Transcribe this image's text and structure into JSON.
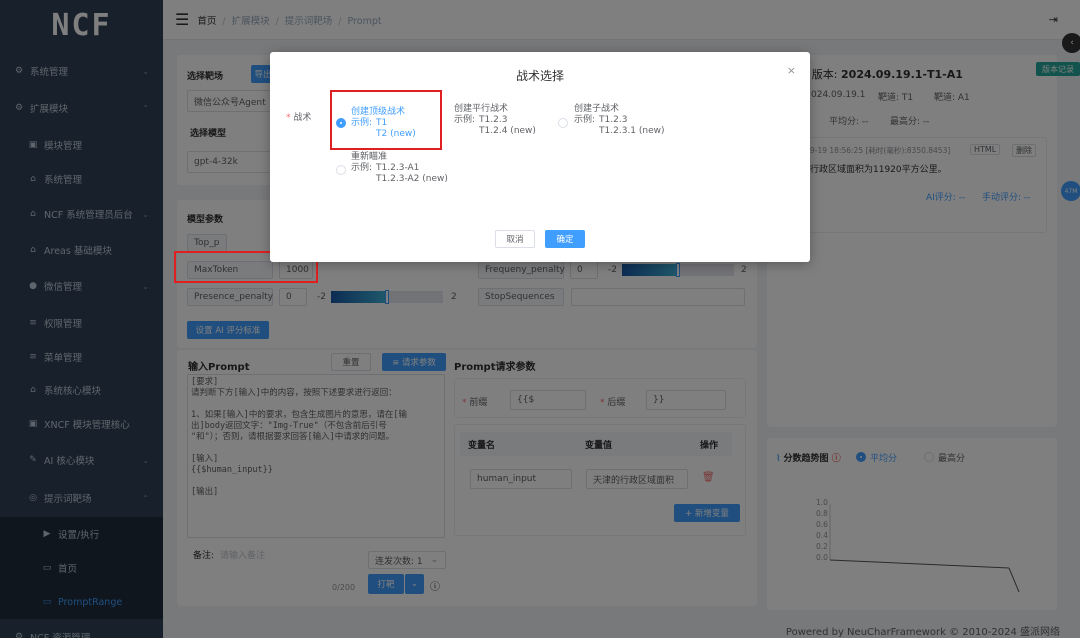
{
  "logo": "NCF",
  "sidebar": {
    "items": [
      {
        "icon": "⚙",
        "label": "系统管理",
        "arrow": "⌄"
      },
      {
        "icon": "⚙",
        "label": "扩展模块",
        "arrow": "⌃"
      },
      {
        "icon": "▣",
        "label": "模块管理",
        "arrow": ""
      },
      {
        "icon": "⌂",
        "label": "系统管理",
        "arrow": ""
      },
      {
        "icon": "⌂",
        "label": "NCF 系统管理员后台",
        "arrow": "⌄"
      },
      {
        "icon": "⌂",
        "label": "Areas 基础模块",
        "arrow": ""
      },
      {
        "icon": "●",
        "label": "微信管理",
        "arrow": "⌄"
      },
      {
        "icon": "≡",
        "label": "权限管理",
        "arrow": ""
      },
      {
        "icon": "≡",
        "label": "菜单管理",
        "arrow": ""
      },
      {
        "icon": "⌂",
        "label": "系统核心模块",
        "arrow": ""
      },
      {
        "icon": "▣",
        "label": "XNCF 模块管理核心",
        "arrow": ""
      },
      {
        "icon": "✎",
        "label": "AI 核心模块",
        "arrow": "⌄"
      },
      {
        "icon": "◎",
        "label": "提示词靶场",
        "arrow": "⌃"
      },
      {
        "icon": "▶",
        "label": "设置/执行",
        "arrow": ""
      },
      {
        "icon": "▭",
        "label": "首页",
        "arrow": ""
      },
      {
        "icon": "▭",
        "label": "PromptRange",
        "arrow": ""
      },
      {
        "icon": "⚙",
        "label": "NCF 资源管理",
        "arrow": "⌄"
      }
    ]
  },
  "breadcrumb": {
    "home": "首页",
    "module": "扩展模块",
    "range": "提示词靶场",
    "current": "Prompt"
  },
  "left": {
    "select_range_label": "选择靶场",
    "export_btn": "导出",
    "range_value": "微信公众号Agent",
    "select_model_label": "选择模型",
    "model_value": "gpt-4-32k",
    "params_title": "模型参数",
    "top_p": "Top_p",
    "max_token": "MaxToken",
    "max_token_value": "1000",
    "presence": "Presence_penalty",
    "presence_value": "0",
    "presence_min": "-2",
    "presence_max": "2",
    "frequency": "Frequeny_penalty",
    "frequency_value": "0",
    "frequency_min": "-2",
    "frequency_max": "2",
    "stop": "StopSequences",
    "ai_score_btn": "设置 AI 评分标准",
    "input_prompt_title": "输入Prompt",
    "reset_btn": "重置",
    "request_btn": "≡ 请求参数",
    "prompt_text": "[要求]\n请判断下方[输入]中的内容，按照下述要求进行返回：\n\n1、如果[输入]中的要求，包含生成图片的意思，请在[输\n出]body返回文字：\"Img-True\"（不包含前后引号\n\"和\"）；否则，请根据要求回答[输入]中请求的问题。\n\n[输入]\n{{$human_input}}\n\n[输出]",
    "note_label": "备注:",
    "note_placeholder": "请输入备注",
    "note_count": "0/200",
    "repeat_label": "连发次数: 1",
    "shoot_btn": "打靶"
  },
  "request_params": {
    "title": "Prompt请求参数",
    "prefix_label": "前缀",
    "prefix_value": "{{$",
    "suffix_label": "后缀",
    "suffix_value": "}}",
    "col_name": "变量名",
    "col_value": "变量值",
    "col_op": "操作",
    "row_name": "human_input",
    "row_value": "天津的行政区域面积",
    "add_btn": "+ 新增变量"
  },
  "right": {
    "version_prefix": "t 版本:",
    "version": "2024.09.19.1-T1-A1",
    "version_tag": "版本记录",
    "date": "024.09.19.1",
    "range_t": "靶道: T1",
    "arrow_a": "靶道: A1",
    "avg": "平均分: --",
    "max": "最高分: --",
    "log_time": "9-19 18:56:25 [耗时(毫秒):8350.8453]",
    "html_tag": "HTML",
    "del_tag": "删除",
    "result": "行政区域面积为11920平方公里。",
    "ai_score": "AI评分: --",
    "manual_score": "手动评分: --",
    "trend_title": "分数趋势图",
    "legend_avg": "平均分",
    "legend_max": "最高分",
    "y_ticks": [
      "1.0",
      "0.8",
      "0.6",
      "0.4",
      "0.2",
      "0.0"
    ]
  },
  "badge": "47M",
  "footer": "Powered by NeuCharFramework © 2010-2024 盛派网络",
  "modal": {
    "title": "战术选择",
    "close": "×",
    "field_label": "战术",
    "opt1_title": "创建顶级战术",
    "opt1_ex_label": "示例:",
    "opt1_ex1": "T1",
    "opt1_ex2": "T2 (new)",
    "opt2_title": "创建平行战术",
    "opt2_ex_label": "示例:",
    "opt2_ex1": "T1.2.3",
    "opt2_ex2": "T1.2.4 (new)",
    "opt3_title": "创建子战术",
    "opt3_ex_label": "示例:",
    "opt3_ex1": "T1.2.3",
    "opt3_ex2": "T1.2.3.1 (new)",
    "opt4_title": "重新瞄准",
    "opt4_ex_label": "示例:",
    "opt4_ex1": "T1.2.3-A1",
    "opt4_ex2": "T1.2.3-A2 (new)",
    "cancel": "取消",
    "confirm": "确定"
  }
}
